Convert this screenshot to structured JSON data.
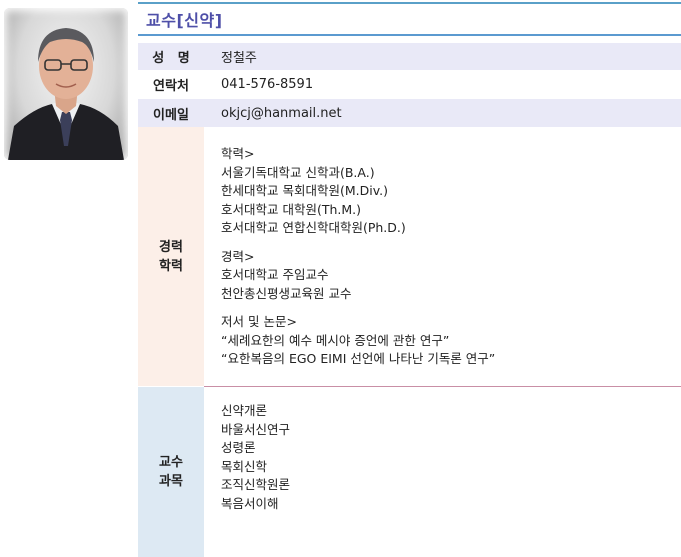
{
  "header": {
    "title": "교수[신약]"
  },
  "profile": {
    "name_label": "성   명",
    "name": "정철주",
    "phone_label": "연락처",
    "phone": "041-576-8591",
    "email_label": "이메일",
    "email": "okjcj@hanmail.net"
  },
  "career": {
    "label_line1": "경력",
    "label_line2": "학력",
    "education_heading": "학력>",
    "education": [
      "서울기독대학교 신학과(B.A.)",
      "한세대학교 목회대학원(M.Div.)",
      "호서대학교 대학원(Th.M.)",
      "호서대학교 연합신학대학원(Ph.D.)"
    ],
    "experience_heading": "경력>",
    "experience": [
      "호서대학교 주임교수",
      "천안총신평생교육원 교수"
    ],
    "publications_heading": "저서 및 논문>",
    "publications": [
      "“세례요한의 예수 메시야 증언에 관한 연구”",
      "“요한복음의 EGO EIMI 선언에 나타난 기독론 연구”"
    ]
  },
  "courses": {
    "label_line1": "교수",
    "label_line2": "과목",
    "items": [
      "신약개론",
      "바울서신연구",
      "성령론",
      "목회신학",
      "조직신학원론",
      "복음서이해"
    ]
  }
}
